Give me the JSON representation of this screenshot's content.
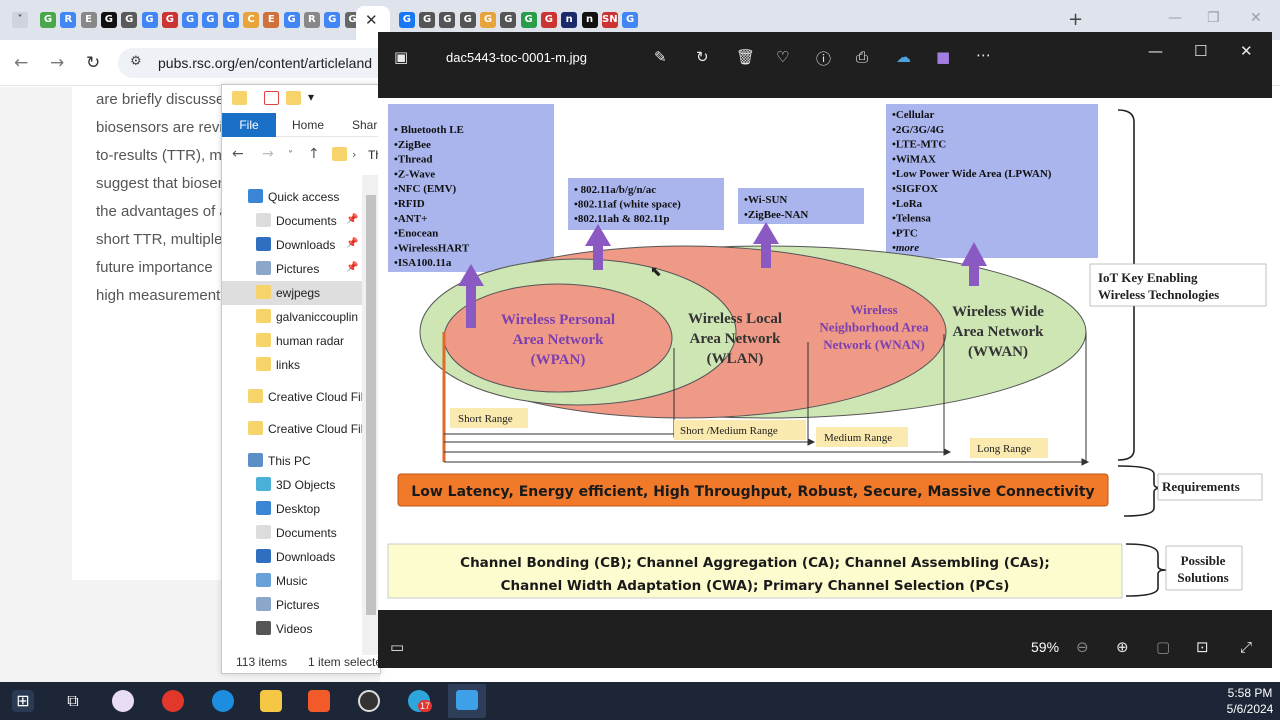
{
  "browser": {
    "url": "pubs.rsc.org/en/content/articleland",
    "tab_glyphs": [
      "G",
      "R",
      "E",
      "G",
      "G",
      "G",
      "G",
      "G",
      "G",
      "G",
      "C",
      "E",
      "G",
      "R",
      "G",
      "G",
      "G",
      "G",
      "G",
      "G",
      "G",
      "G",
      "G",
      "G",
      "n",
      "n",
      "SN",
      "G"
    ],
    "new_tab_glyph": "+"
  },
  "article": {
    "lines": [
      "are briefly discusse",
      "biosensors are revi",
      "to-results (TTR), m",
      "suggest that biosen",
      "the advantages of a",
      "short TTR, multiple",
      "future importance",
      "high measurement"
    ]
  },
  "explorer": {
    "ribbon_tabs": [
      "File",
      "Home",
      "Share"
    ],
    "path_partial": "Th",
    "tree": [
      {
        "label": "Quick access",
        "pinned": false
      },
      {
        "label": "Documents",
        "pinned": true
      },
      {
        "label": "Downloads",
        "pinned": true
      },
      {
        "label": "Pictures",
        "pinned": true
      },
      {
        "label": "ewjpegs",
        "pinned": false
      },
      {
        "label": "galvaniccouplin",
        "pinned": false
      },
      {
        "label": "human radar",
        "pinned": false
      },
      {
        "label": "links",
        "pinned": false
      },
      {
        "label": "Creative Cloud Fil",
        "pinned": false
      },
      {
        "label": "Creative Cloud Fil",
        "pinned": false
      },
      {
        "label": "This PC",
        "pinned": false
      },
      {
        "label": "3D Objects",
        "pinned": false
      },
      {
        "label": "Desktop",
        "pinned": false
      },
      {
        "label": "Documents",
        "pinned": false
      },
      {
        "label": "Downloads",
        "pinned": false
      },
      {
        "label": "Music",
        "pinned": false
      },
      {
        "label": "Pictures",
        "pinned": false
      },
      {
        "label": "Videos",
        "pinned": false
      }
    ],
    "status_count": "113 items",
    "status_selected": "1 item selecte"
  },
  "viewer": {
    "filename": "dac5443-toc-0001-m.jpg",
    "zoom": "59%",
    "image": {
      "box1": [
        "• Bluetooth LE",
        "•ZigBee",
        "•Thread",
        "•Z-Wave",
        "•NFC (EMV)",
        "•RFID",
        "•ANT+",
        "•Enocean",
        "•WirelessHART",
        "•ISA100.11a"
      ],
      "box2": [
        "• 802.11a/b/g/n/ac",
        "•802.11af (white space)",
        "•802.11ah & 802.11p"
      ],
      "box3": [
        "•Wi-SUN",
        "•ZigBee-NAN"
      ],
      "box4": [
        "•Cellular",
        "•2G/3G/4G",
        "•LTE-MTC",
        "•WiMAX",
        "•Low Power Wide Area (LPWAN)",
        "•SIGFOX",
        "•LoRa",
        "•Telensa",
        "•PTC",
        "•more"
      ],
      "wpan": [
        "Wireless Personal",
        "Area Network",
        "(WPAN)"
      ],
      "wlan": [
        "Wireless Local",
        "Area Network",
        "(WLAN)"
      ],
      "wnan": [
        "Wireless",
        "Neighborhood Area",
        "Network (WNAN)"
      ],
      "wwan": [
        "Wireless Wide",
        "Area Network",
        "(WWAN)"
      ],
      "ranges": [
        "Short Range",
        "Short /Medium Range",
        "Medium Range",
        "Long Range"
      ],
      "iot_label": [
        "IoT Key Enabling",
        "Wireless Technologies"
      ],
      "requirements_bar": "Low Latency, Energy efficient, High Throughput, Robust, Secure, Massive Connectivity",
      "requirements_label": "Requirements",
      "solutions_line1": "Channel Bonding (CB); Channel Aggregation (CA); Channel Assembling (CAs);",
      "solutions_line2": "Channel Width Adaptation (CWA); Primary Channel Selection (PCs)",
      "solutions_label": [
        "Possible",
        "Solutions"
      ]
    }
  },
  "taskbar": {
    "badge": "17",
    "time": "5:58 PM",
    "date": "5/6/2024"
  },
  "colors": {
    "tabstrip": "#dfe3eb",
    "viewer_bg": "#1f1f1f",
    "taskbar": "#1c2636",
    "wpan_fill": "#ee9a86",
    "green_fill": "#cde6b4",
    "arrow": "#8a5ac2",
    "purple_text": "#7b3fb0",
    "orange_bar": "#f07a2a",
    "yellow_box": "#fdfccf",
    "blue_box": "#aab5ee"
  }
}
